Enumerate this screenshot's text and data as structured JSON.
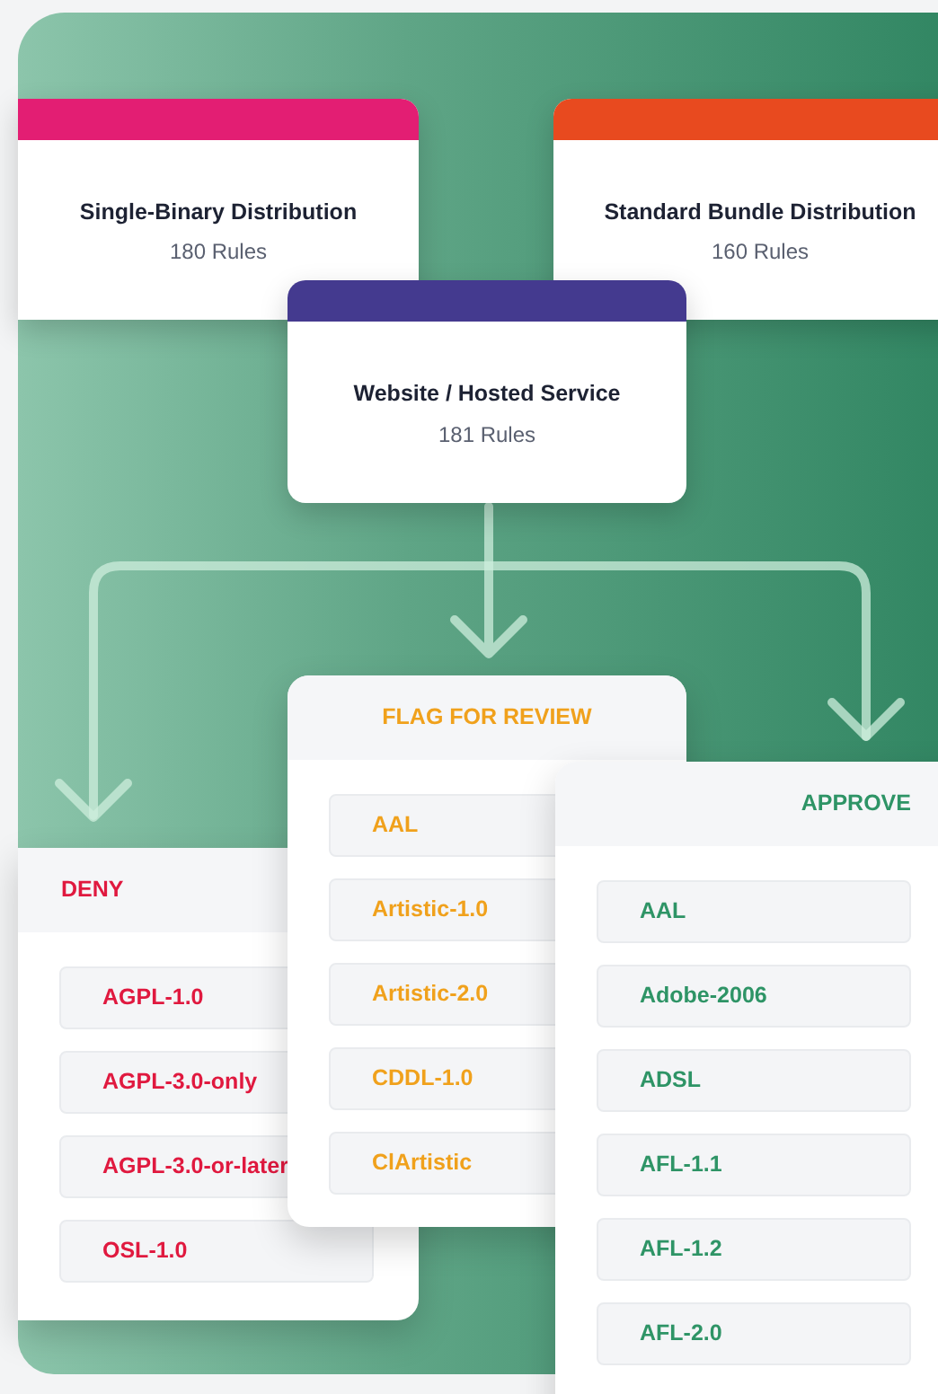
{
  "sources": [
    {
      "title": "Single-Binary Distribution",
      "rules": "180 Rules",
      "color": "#e31e73"
    },
    {
      "title": "Standard Bundle Distribution",
      "rules": "160 Rules",
      "color": "#e84a1f"
    },
    {
      "title": "Website / Hosted Service",
      "rules": "181 Rules",
      "color": "#443a8f"
    }
  ],
  "columns": [
    {
      "kind": "deny",
      "title": "DENY",
      "items": [
        "AGPL-1.0",
        "AGPL-3.0-only",
        "AGPL-3.0-or-later",
        "OSL-1.0"
      ]
    },
    {
      "kind": "flag",
      "title": "FLAG FOR REVIEW",
      "items": [
        "AAL",
        "Artistic-1.0",
        "Artistic-2.0",
        "CDDL-1.0",
        "ClArtistic"
      ]
    },
    {
      "kind": "approve",
      "title": "APPROVE",
      "items": [
        "AAL",
        "Adobe-2006",
        "ADSL",
        "AFL-1.1",
        "AFL-1.2",
        "AFL-2.0"
      ]
    }
  ]
}
